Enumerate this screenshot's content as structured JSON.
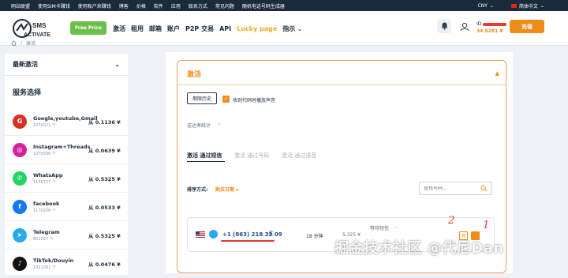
{
  "topbar": {
    "links": [
      "网站联盟",
      "使用SIM卡赚钱",
      "使用账户来赚钱",
      "博客",
      "价格",
      "软件",
      "应用",
      "联系方式",
      "常见问题",
      "随机电话号码生成器"
    ],
    "currency": "CNY",
    "language": "简体中文"
  },
  "header": {
    "logo_text": "SMS ACTIVATE",
    "free_price": "Free Price",
    "nav": [
      "激活",
      "租用",
      "邮箱",
      "账户",
      "P2P 交易",
      "API"
    ],
    "lucky": "Lucky page",
    "guide": "指示",
    "id_label": "ID",
    "balance": "34.6281 ¥",
    "topup": "充值"
  },
  "breadcrumb": {
    "current": "激活"
  },
  "sidebar": {
    "recent": "最新激活",
    "title": "服务选择",
    "services": [
      {
        "name": "Google,youtube,Gmail",
        "count": "1070021 个",
        "price": "从 0.1136 ¥",
        "color": "#d93025",
        "glyph": "G"
      },
      {
        "name": "Instagram+Threads",
        "count": "1070596 个",
        "price": "从 0.0639 ¥",
        "color": "#d6249f",
        "glyph": "◎"
      },
      {
        "name": "WhatsApp",
        "count": "1136727 个",
        "price": "从 0.5325 ¥",
        "color": "#25d366",
        "glyph": "✆"
      },
      {
        "name": "facebook",
        "count": "1170206 个",
        "price": "从 0.0533 ¥",
        "color": "#1877f2",
        "glyph": "f"
      },
      {
        "name": "Telegram",
        "count": "801067 个",
        "price": "从 0.5325 ¥",
        "color": "#29a9eb",
        "glyph": "➤"
      },
      {
        "name": "TikTok/Douyin",
        "count": "1321261 个",
        "price": "从 0.0476 ¥",
        "color": "#111111",
        "glyph": "♪"
      }
    ]
  },
  "card": {
    "title": "激活",
    "history_btn": "期限历史",
    "sound_label": "收到代码时播放声音",
    "stats": "送达率统计",
    "tabs": [
      "激活 通过短信",
      "激活 通过号码",
      "激活 通过语音"
    ],
    "sort_label": "排序方式:",
    "sort_value": "购买日期",
    "search_placeholder": "查找号码...",
    "row": {
      "phone": "+1 (863) 218 33 09",
      "time": "18 分钟",
      "price": "5.325 ¥",
      "status": "等待短信"
    }
  },
  "annotations": {
    "two": "2",
    "one": "1"
  },
  "watermark": "掘金技术社区 @代尼Dan"
}
